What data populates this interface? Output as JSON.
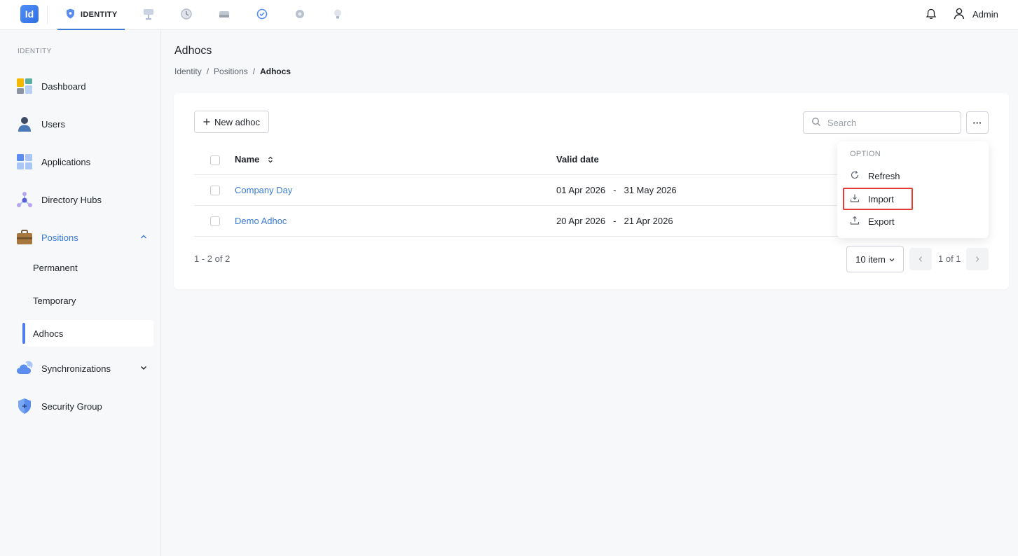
{
  "topbar": {
    "logo": "Id",
    "active_tab": "IDENTITY",
    "user": "Admin"
  },
  "sidebar": {
    "section": "IDENTITY",
    "items": [
      {
        "label": "Dashboard"
      },
      {
        "label": "Users"
      },
      {
        "label": "Applications"
      },
      {
        "label": "Directory Hubs"
      },
      {
        "label": "Positions"
      },
      {
        "label": "Synchronizations"
      },
      {
        "label": "Security Group"
      }
    ],
    "positions_sub": [
      {
        "label": "Permanent"
      },
      {
        "label": "Temporary"
      },
      {
        "label": "Adhocs"
      }
    ]
  },
  "page": {
    "title": "Adhocs",
    "breadcrumb": [
      "Identity",
      "/",
      "Positions",
      "/",
      "Adhocs"
    ]
  },
  "toolbar": {
    "new_label": "New adhoc",
    "search_placeholder": "Search",
    "more_label": "···"
  },
  "table": {
    "columns": {
      "name": "Name",
      "valid_date": "Valid date"
    },
    "rows": [
      {
        "name": "Company Day",
        "start": "01 Apr 2026",
        "sep": "-",
        "end": "31 May 2026"
      },
      {
        "name": "Demo Adhoc",
        "start": "20 Apr 2026",
        "sep": "-",
        "end": "21 Apr 2026"
      }
    ]
  },
  "pagination": {
    "range": "1 - 2 of 2",
    "page_size": "10 item",
    "page_info": "1 of 1"
  },
  "dropdown": {
    "header": "OPTION",
    "items": [
      {
        "label": "Refresh"
      },
      {
        "label": "Import"
      },
      {
        "label": "Export"
      }
    ]
  },
  "colors": {
    "accent": "#3a7bd5",
    "highlight_border": "#e53935"
  }
}
